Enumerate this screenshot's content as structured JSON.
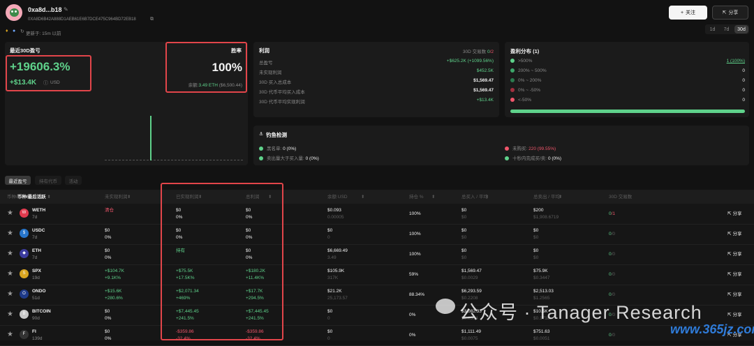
{
  "profile": {
    "name": "0xa8d...b18",
    "address": "0XA8D6B42A888D1AEB61E6B7DCE475C964BD72EB18",
    "joined": "更新于: 15m 以前",
    "follow_label": "关注",
    "share_label": "分享",
    "periods": [
      "1d",
      "7d",
      "30d"
    ],
    "active_period": "30d"
  },
  "pnl_card": {
    "title": "最近30D盈亏",
    "percent": "+19606.3%",
    "amount": "+$13.4K",
    "currency": "USD"
  },
  "winrate_card": {
    "title": "胜率",
    "value": "100%",
    "balance_label": "余额:",
    "balance_value": "3.49 ETH",
    "balance_usd": "($6,500.44)"
  },
  "profit_card": {
    "title": "利润",
    "tx_label": "30D 交易数",
    "tx_value": "0",
    "tx_total": "/2",
    "rows": [
      {
        "label": "总盈亏",
        "value": "+$625.2K (+1099.56%)"
      },
      {
        "label": "未实现利润",
        "value": "$452.5K"
      },
      {
        "label": "30D 买入总成本",
        "value": "$1,569.47"
      },
      {
        "label": "30D 代币平均买入成本",
        "value": "$1,569.47"
      },
      {
        "label": "30D 代币平均实现利润",
        "value": "+$13.4K"
      }
    ]
  },
  "distribution_card": {
    "title": "盈利分布 (1)",
    "rows": [
      {
        "label": ">500%",
        "value": "1 (100%)",
        "color": "#5fd28b"
      },
      {
        "label": "200% ~ 500%",
        "value": "0",
        "color": "#3da66a"
      },
      {
        "label": "0% ~ 200%",
        "value": "0",
        "color": "#2b7a4e"
      },
      {
        "label": "0% ~ -50%",
        "value": "0",
        "color": "#a0303f"
      },
      {
        "label": "<-50%",
        "value": "0",
        "color": "#f0566b"
      }
    ],
    "fill_fraction": 1.0
  },
  "phishing_card": {
    "title": "钓鱼检测",
    "items": [
      {
        "label": "黑名单:",
        "value": "0 (0%)",
        "color": "#5fd28b",
        "value_class": "white"
      },
      {
        "label": "未购买:",
        "value": "220 (99.55%)",
        "color": "#f0566b",
        "value_class": "red"
      },
      {
        "label": "卖出量大于买入量:",
        "value": "0 (0%)",
        "color": "#5fd28b",
        "value_class": "white"
      },
      {
        "label": "十秒内完成买/卖:",
        "value": "0 (0%)",
        "color": "#5fd28b",
        "value_class": "white"
      }
    ]
  },
  "tabs": [
    "最近盈亏",
    "持有代币",
    "活动"
  ],
  "table": {
    "headers": [
      "币种/最后活跃",
      "未实现利润",
      "已实现利润",
      "总利润",
      "余额 USD",
      "持仓 %",
      "总买入 / 平均",
      "总卖出 / 平均",
      "30D 交易数"
    ],
    "share_label": "分享",
    "rows": [
      {
        "token": "WETH",
        "age": "7d",
        "unreal1": "清仓",
        "unreal1_class": "red",
        "unreal2": "",
        "real1": "$0",
        "real1_class": "white",
        "real2": "0%",
        "total1": "$0",
        "total1_class": "white",
        "total2": "0%",
        "bal1": "$0.093",
        "bal2": "0.00005",
        "hold": "100%",
        "buy1": "$0",
        "buy2": "$0",
        "sell1": "$200",
        "sell2": "$1,908.6719",
        "tx1": "0",
        "tx2": "/1",
        "icon_color": "#e03a4e",
        "icon_letter": "W"
      },
      {
        "token": "USDC",
        "age": "7d",
        "unreal1": "$0",
        "unreal1_class": "white",
        "unreal2": "0%",
        "real1": "$0",
        "real1_class": "white",
        "real2": "0%",
        "total1": "$0",
        "total1_class": "white",
        "total2": "0%",
        "bal1": "$0",
        "bal2": "0",
        "hold": "100%",
        "buy1": "$0",
        "buy2": "$0",
        "sell1": "$0",
        "sell2": "$0",
        "tx1": "0",
        "tx2": "/0",
        "icon_color": "#2775ca",
        "icon_letter": "$"
      },
      {
        "token": "ETH",
        "age": "7d",
        "unreal1": "$0",
        "unreal1_class": "white",
        "unreal2": "0%",
        "real1": "持有",
        "real1_class": "green",
        "real2": "",
        "total1": "$0",
        "total1_class": "white",
        "total2": "0%",
        "bal1": "$6,669.49",
        "bal2": "3.49",
        "hold": "100%",
        "buy1": "$0",
        "buy2": "$0",
        "sell1": "$0",
        "sell2": "$0",
        "tx1": "0",
        "tx2": "/0",
        "icon_color": "#3c3c9e",
        "icon_letter": "◆"
      },
      {
        "token": "SPX",
        "age": "19d",
        "unreal1": "+$104.7K",
        "unreal1_class": "green",
        "unreal2": "+9.1K%",
        "real1": "+$75.5K",
        "real1_class": "green",
        "real2": "+17.5K%",
        "total1": "+$180.2K",
        "total1_class": "green",
        "total2": "+11.4K%",
        "bal1": "$105.9K",
        "bal2": "317K",
        "hold": "59%",
        "buy1": "$1,569.47",
        "buy2": "$0.0029",
        "sell1": "$75.9K",
        "sell2": "$0.3447",
        "tx1": "0",
        "tx2": "/0",
        "icon_color": "#d9a520",
        "icon_letter": "S"
      },
      {
        "token": "ONDO",
        "age": "51d",
        "unreal1": "+$15.6K",
        "unreal1_class": "green",
        "unreal2": "+280.6%",
        "real1": "+$2,071.34",
        "real1_class": "green",
        "real2": "+469%",
        "total1": "+$17.7K",
        "total1_class": "green",
        "total2": "+294.5%",
        "bal1": "$21.2K",
        "bal2": "25,173.57",
        "hold": "88.34%",
        "buy1": "$6,293.59",
        "buy2": "$0.2208",
        "sell1": "$2,513.03",
        "sell2": "$1.2565",
        "tx1": "0",
        "tx2": "/0",
        "icon_color": "#1e3a8a",
        "icon_letter": "O"
      },
      {
        "token": "BITCOIN",
        "age": "90d",
        "unreal1": "$0",
        "unreal1_class": "white",
        "unreal2": "0%",
        "real1": "+$7,445.45",
        "real1_class": "green",
        "real2": "+241.5%",
        "total1": "+$7,445.45",
        "total1_class": "green",
        "total2": "+241.5%",
        "bal1": "$0",
        "bal2": "0",
        "hold": "0%",
        "buy1": "$3,082.33",
        "buy2": "$0.0304",
        "sell1": "$10.5K",
        "sell2": "$0.1718",
        "tx1": "0",
        "tx2": "/0",
        "icon_color": "#c9c9c9",
        "icon_letter": "B"
      },
      {
        "token": "FI",
        "age": "139d",
        "unreal1": "$0",
        "unreal1_class": "white",
        "unreal2": "0%",
        "real1": "-$359.86",
        "real1_class": "red",
        "real2": "-32.4%",
        "total1": "-$359.86",
        "total1_class": "red",
        "total2": "-32.4%",
        "bal1": "$0",
        "bal2": "0",
        "hold": "0%",
        "buy1": "$1,111.49",
        "buy2": "$0.0075",
        "sell1": "$751.63",
        "sell2": "$0.0051",
        "tx1": "0",
        "tx2": "/0",
        "icon_color": "#333333",
        "icon_letter": "F"
      }
    ]
  },
  "watermark": {
    "text": "公众号 · Tanager Research",
    "site": "www.365jz.com"
  }
}
